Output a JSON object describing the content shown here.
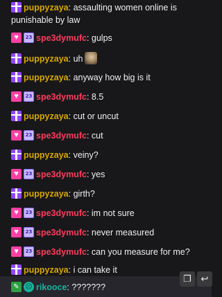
{
  "colors": {
    "puppyzaya": "#d8a800",
    "spe3dymufc": "#ff3a5c",
    "rikooce": "#19b4a0",
    "background": "#18181b"
  },
  "badges": {
    "gift": "gift-badge-icon",
    "sub_heart": "heart-badge-icon",
    "sub_months": "23",
    "moderator": "pencil-badge-icon",
    "face": "face-badge-icon"
  },
  "messages": [
    {
      "user": "puppyzaya",
      "text": "assaulting women online is punishable by law"
    },
    {
      "user": "spe3dymufc",
      "text": "gulps"
    },
    {
      "user": "puppyzaya",
      "text": "uh",
      "emote": "emote-image"
    },
    {
      "user": "puppyzaya",
      "text": "anyway how big is it"
    },
    {
      "user": "spe3dymufc",
      "text": "8.5"
    },
    {
      "user": "puppyzaya",
      "text": "cut or uncut"
    },
    {
      "user": "spe3dymufc",
      "text": "cut"
    },
    {
      "user": "puppyzaya",
      "text": "veiny?"
    },
    {
      "user": "spe3dymufc",
      "text": "yes"
    },
    {
      "user": "puppyzaya",
      "text": "girth?"
    },
    {
      "user": "spe3dymufc",
      "text": "im not sure"
    },
    {
      "user": "spe3dymufc",
      "text": "never measured"
    },
    {
      "user": "spe3dymufc",
      "text": "can you measure for me?"
    },
    {
      "user": "puppyzaya",
      "text": "i can take it"
    },
    {
      "user": "rikooce",
      "text": "???????"
    }
  ],
  "actions": {
    "copy_icon": "copy-icon",
    "reply_icon": "reply-icon"
  },
  "separator": ": "
}
